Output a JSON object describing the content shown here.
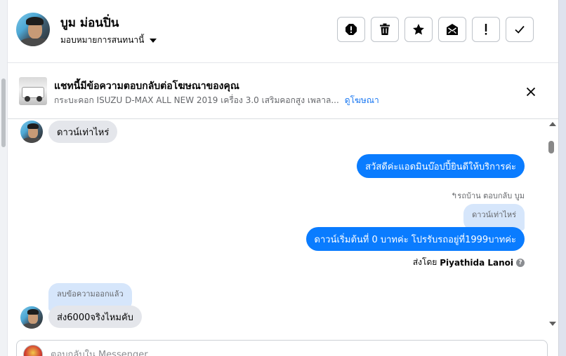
{
  "header": {
    "contact_name": "บูม ม่อนปิ่น",
    "assign_label": "มอบหมายการสนทนานี้",
    "actions": [
      {
        "name": "report-spam-icon",
        "tooltip": ""
      },
      {
        "name": "trash-icon",
        "tooltip": ""
      },
      {
        "name": "star-icon",
        "tooltip": ""
      },
      {
        "name": "mark-unread-icon",
        "tooltip": ""
      },
      {
        "name": "follow-up-icon",
        "tooltip": ""
      },
      {
        "name": "done-check-icon",
        "tooltip": ""
      }
    ]
  },
  "ad_banner": {
    "title": "แชทนี้มีข้อความตอบกลับต่อโฆษณาของคุณ",
    "description": "กระบะคอก ISUZU D-MAX ALL NEW 2019 เครื่อง 3.0 เสริมคอกสูง เพลาล...",
    "link_label": "ดูโฆษณา"
  },
  "messages": {
    "m1": {
      "text": "ดาวน์เท่าไหร่"
    },
    "m2": {
      "text": "สวัสดีค่ะแอดมินบ๊อปปี้ยินดีให้บริการค่ะ"
    },
    "reply_meta": "↰รถบ้าน ตอบกลับ บูม",
    "quoted": "ดาวน์เท่าไหร่",
    "m3": {
      "text": "ดาวน์เริ่มต้นที่ 0 บาทค่ะ โปรรับรถอยู่ที่1999บาทค่ะ"
    },
    "sent_by_label": "ส่งโดย",
    "sent_by_name": "Piyathida Lanoi",
    "deleted": "ลบข้อความออกแล้ว",
    "m4": {
      "text": "ส่ง6000จริงไหมคับ"
    }
  },
  "composer": {
    "placeholder": "ตอบกลับใน Messenger"
  },
  "colors": {
    "outgoing_bubble": "#0a7cff",
    "incoming_bubble": "#e4e6eb",
    "quoted_bubble": "#d6e6fb",
    "link": "#1877f2"
  }
}
